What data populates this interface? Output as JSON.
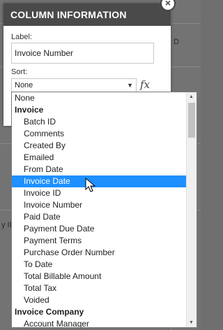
{
  "background": {
    "fragments": [
      "D",
      "y ID"
    ]
  },
  "dialog": {
    "title": "COLUMN INFORMATION",
    "close_glyph": "×",
    "label_caption": "Label:",
    "label_value": "Invoice Number",
    "sort_caption": "Sort:",
    "sort_value": "None",
    "fx_icon": "fx-icon"
  },
  "dropdown": {
    "items": [
      {
        "text": "None",
        "kind": "plain"
      },
      {
        "text": "Invoice",
        "kind": "group"
      },
      {
        "text": "Batch ID",
        "kind": "child"
      },
      {
        "text": "Comments",
        "kind": "child"
      },
      {
        "text": "Created By",
        "kind": "child"
      },
      {
        "text": "Emailed",
        "kind": "child"
      },
      {
        "text": "From Date",
        "kind": "child"
      },
      {
        "text": "Invoice Date",
        "kind": "child",
        "selected": true
      },
      {
        "text": "Invoice ID",
        "kind": "child"
      },
      {
        "text": "Invoice Number",
        "kind": "child"
      },
      {
        "text": "Paid Date",
        "kind": "child"
      },
      {
        "text": "Payment Due Date",
        "kind": "child"
      },
      {
        "text": "Payment Terms",
        "kind": "child"
      },
      {
        "text": "Purchase Order Number",
        "kind": "child"
      },
      {
        "text": "To Date",
        "kind": "child"
      },
      {
        "text": "Total Billable Amount",
        "kind": "child"
      },
      {
        "text": "Total Tax",
        "kind": "child"
      },
      {
        "text": "Voided",
        "kind": "child"
      },
      {
        "text": "Invoice Company",
        "kind": "group"
      },
      {
        "text": "Account Manager",
        "kind": "child"
      }
    ],
    "selected_color": "#1e90ff"
  }
}
